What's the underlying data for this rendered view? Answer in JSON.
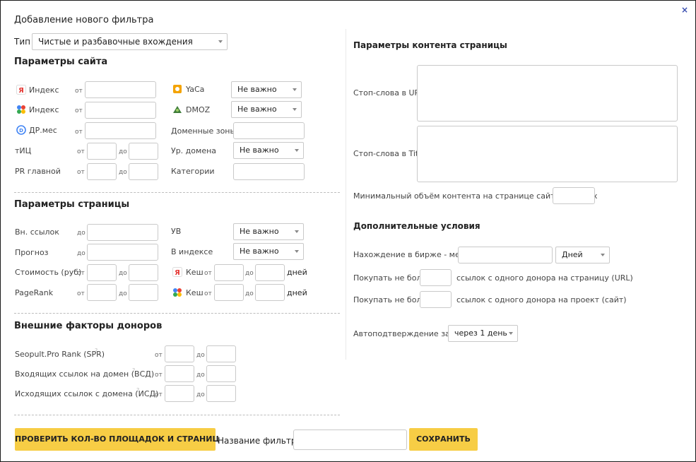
{
  "dialog": {
    "title": "Добавление нового фильтра",
    "close": "×"
  },
  "type": {
    "label": "Тип",
    "value": "Чистые и разбавочные вхождения"
  },
  "site": {
    "heading": "Параметры сайта",
    "yandex_index": "Индекс",
    "google_index": "Индекс",
    "dr_mes": "ДР.мес",
    "tic": "тИЦ",
    "pr_main": "PR главной",
    "yaca": "YaCa",
    "dmoz": "DMOZ",
    "domain_zones": "Доменные зоны",
    "domain_level": "Ур. домена",
    "categories": "Категории",
    "not_important": "Не важно"
  },
  "page": {
    "heading": "Параметры страницы",
    "out_links": "Вн. ссылок",
    "forecast": "Прогноз",
    "cost": "Стоимость (руб)",
    "pagerank": "PageRank",
    "uv": "УВ",
    "in_index": "В индексе",
    "cache": "Кеш",
    "days": "дней"
  },
  "donors": {
    "heading": "Внешние факторы доноров",
    "spr": "Seopult.Pro Rank (SPR)",
    "vsd": "Входящих ссылок на домен (ВСД)",
    "isd": "Исходящих ссылок с домена (ИСД)"
  },
  "common": {
    "from": "от",
    "to": "до",
    "q": "?"
  },
  "content": {
    "heading": "Параметры контента страницы",
    "stop_url": "Стоп-слова в URL",
    "stop_title": "Стоп-слова в Title",
    "min_volume": "Минимальный объём контента на странице сайта в знаках"
  },
  "extra": {
    "heading": "Дополнительные условия",
    "exchange": "Нахождение в бирже - менее",
    "days_value": "Дней",
    "buy_page": "Покупать не более",
    "buy_page_suffix": "ссылок с одного донора на страницу (URL)",
    "buy_project": "Покупать не более",
    "buy_project_suffix": "ссылок с одного донора на проект (сайт)",
    "auto_confirm": "Автоподтверждение заявок",
    "auto_confirm_value": "через 1 день"
  },
  "footer": {
    "check_button": "ПРОВЕРИТЬ КОЛ-ВО ПЛОЩАДОК И СТРАНИЦ",
    "filter_name_label": "Название фильтра",
    "save_button": "СОХРАНИТЬ"
  },
  "colors": {
    "button": "#f7cd45",
    "close": "#3a4fb0",
    "yandex": "#e53935",
    "google_blue": "#4285f4",
    "yaca": "#f4a300",
    "dmoz": "#3f7d3a"
  }
}
